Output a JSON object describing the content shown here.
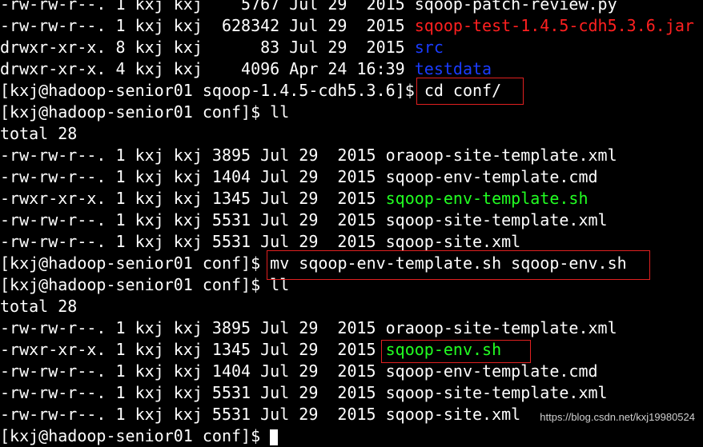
{
  "terminal": {
    "lines": [
      [
        "-rw-rw-r--. 1 kxj kxj    5767 Jul 29  2015 ",
        "sqoop-patch-review.py",
        ""
      ],
      [
        "-rw-rw-r--. 1 kxj kxj  628342 Jul 29  2015 ",
        "sqoop-test-1.4.5-cdh5.3.6.jar",
        "red"
      ],
      [
        "drwxr-xr-x. 8 kxj kxj      83 Jul 29  2015 ",
        "src",
        "blue"
      ],
      [
        "drwxr-xr-x. 4 kxj kxj    4096 Apr 24 16:39 ",
        "testdata",
        "blue"
      ],
      [
        "[kxj@hadoop-senior01 sqoop-1.4.5-cdh5.3.6]$ ",
        "cd conf/",
        ""
      ],
      [
        "[kxj@hadoop-senior01 conf]$ ",
        "ll",
        ""
      ],
      [
        "total 28",
        "",
        ""
      ],
      [
        "-rw-rw-r--. 1 kxj kxj 3895 Jul 29  2015 ",
        "oraoop-site-template.xml",
        ""
      ],
      [
        "-rw-rw-r--. 1 kxj kxj 1404 Jul 29  2015 ",
        "sqoop-env-template.cmd",
        ""
      ],
      [
        "-rwxr-xr-x. 1 kxj kxj 1345 Jul 29  2015 ",
        "sqoop-env-template.sh",
        "green"
      ],
      [
        "-rw-rw-r--. 1 kxj kxj 5531 Jul 29  2015 ",
        "sqoop-site-template.xml",
        ""
      ],
      [
        "-rw-rw-r--. 1 kxj kxj 5531 Jul 29  2015 ",
        "sqoop-site.xml",
        ""
      ],
      [
        "[kxj@hadoop-senior01 conf]$ ",
        "mv sqoop-env-template.sh sqoop-env.sh",
        ""
      ],
      [
        "[kxj@hadoop-senior01 conf]$ ",
        "ll",
        ""
      ],
      [
        "total 28",
        "",
        ""
      ],
      [
        "-rw-rw-r--. 1 kxj kxj 3895 Jul 29  2015 ",
        "oraoop-site-template.xml",
        ""
      ],
      [
        "-rwxr-xr-x. 1 kxj kxj 1345 Jul 29  2015 ",
        "sqoop-env.sh",
        "green"
      ],
      [
        "-rw-rw-r--. 1 kxj kxj 1404 Jul 29  2015 ",
        "sqoop-env-template.cmd",
        ""
      ],
      [
        "-rw-rw-r--. 1 kxj kxj 5531 Jul 29  2015 ",
        "sqoop-site-template.xml",
        ""
      ],
      [
        "-rw-rw-r--. 1 kxj kxj 5531 Jul 29  2015 ",
        "sqoop-site.xml",
        ""
      ],
      [
        "[kxj@hadoop-senior01 conf]$ ",
        "",
        ""
      ]
    ]
  },
  "watermark": "https://blog.csdn.net/kxj19980524",
  "colors": {
    "background": "#000000",
    "text": "#ffffff",
    "jar": "#ff2020",
    "directory": "#1a3cff",
    "executable": "#22ff22",
    "highlight_box": "#e02020"
  }
}
